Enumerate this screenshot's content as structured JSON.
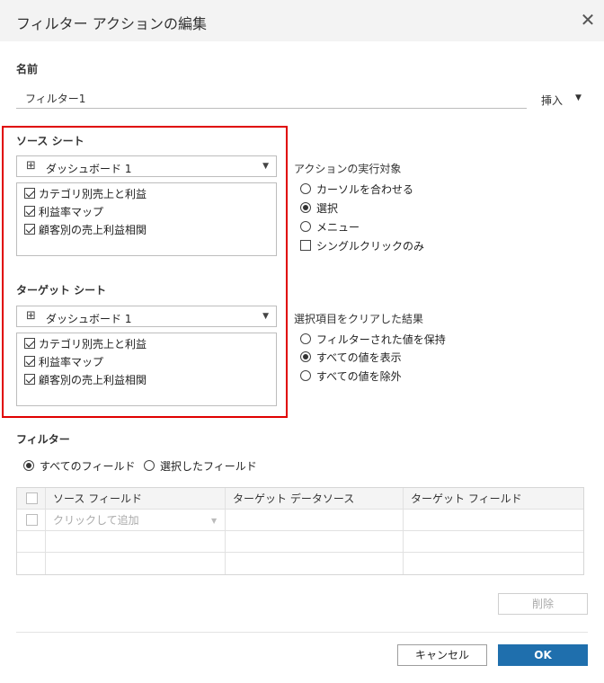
{
  "dialog": {
    "title": "フィルター アクションの編集",
    "close_glyph": "✕"
  },
  "name_section": {
    "label": "名前",
    "value": "フィルター1",
    "insert_label": "挿入",
    "insert_caret": "▼"
  },
  "source": {
    "heading": "ソース シート",
    "dropdown_icon": "⊞",
    "dropdown_value": "ダッシュボード 1",
    "dropdown_caret": "▼",
    "items": [
      {
        "label": "カテゴリ別売上と利益",
        "checked": true
      },
      {
        "label": "利益率マップ",
        "checked": true
      },
      {
        "label": "顧客別の売上利益相関",
        "checked": true
      }
    ]
  },
  "target": {
    "heading": "ターゲット シート",
    "dropdown_icon": "⊞",
    "dropdown_value": "ダッシュボード 1",
    "dropdown_caret": "▼",
    "items": [
      {
        "label": "カテゴリ別売上と利益",
        "checked": true
      },
      {
        "label": "利益率マップ",
        "checked": true
      },
      {
        "label": "顧客別の売上利益相関",
        "checked": true
      }
    ]
  },
  "run_on": {
    "heading": "アクションの実行対象",
    "options": [
      {
        "label": "カーソルを合わせる",
        "selected": false
      },
      {
        "label": "選択",
        "selected": true
      },
      {
        "label": "メニュー",
        "selected": false
      }
    ],
    "single_click_label": "シングルクリックのみ",
    "single_click_checked": false
  },
  "clear_selection": {
    "heading": "選択項目をクリアした結果",
    "options": [
      {
        "label": "フィルターされた値を保持",
        "selected": false
      },
      {
        "label": "すべての値を表示",
        "selected": true
      },
      {
        "label": "すべての値を除外",
        "selected": false
      }
    ]
  },
  "filters": {
    "heading": "フィルター",
    "options": [
      {
        "label": "すべてのフィールド",
        "selected": true
      },
      {
        "label": "選択したフィールド",
        "selected": false
      }
    ],
    "table": {
      "columns": [
        "ソース フィールド",
        "ターゲット データソース",
        "ターゲット フィールド"
      ],
      "add_placeholder": "クリックして追加",
      "add_caret": "▼"
    }
  },
  "buttons": {
    "delete": "削除",
    "cancel": "キャンセル",
    "ok": "OK"
  },
  "colors": {
    "highlight_border": "#e00000",
    "ok_button": "#1f6fad"
  }
}
